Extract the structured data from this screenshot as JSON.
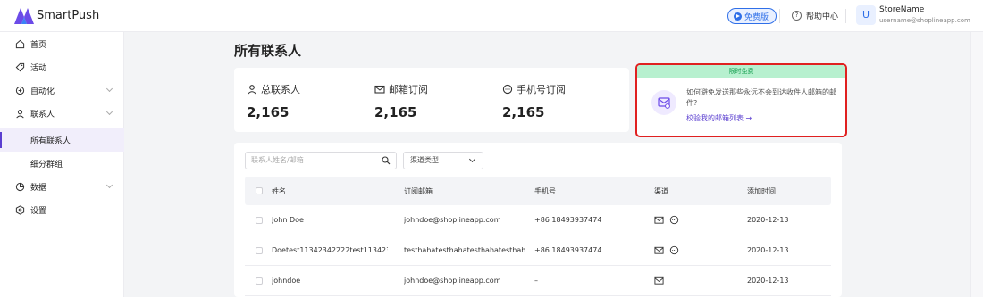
{
  "app": {
    "brand": "SmartPush",
    "free_badge": "免费版",
    "help": "帮助中心",
    "avatar_letter": "U",
    "store_name": "StoreName",
    "store_email": "username@shoplineapp.com"
  },
  "sidebar": {
    "items": [
      {
        "label": "首页",
        "icon": "home-icon"
      },
      {
        "label": "活动",
        "icon": "tag-icon"
      },
      {
        "label": "自动化",
        "icon": "automation-icon"
      },
      {
        "label": "联系人",
        "icon": "user-icon"
      },
      {
        "label": "所有联系人"
      },
      {
        "label": "细分群组"
      },
      {
        "label": "数据",
        "icon": "chart-icon"
      },
      {
        "label": "设置",
        "icon": "settings-icon"
      }
    ]
  },
  "page": {
    "title": "所有联系人"
  },
  "stats": {
    "total_label": "总联系人",
    "total_value": "2,165",
    "email_label": "邮箱订阅",
    "email_value": "2,165",
    "sms_label": "手机号订阅",
    "sms_value": "2,165"
  },
  "promo": {
    "header": "限时免费",
    "text": "如何避免发送那些永远不会到达收件人邮箱的邮件?",
    "link": "校验我的邮箱列表 →"
  },
  "filters": {
    "search_placeholder": "联系人姓名/邮箱",
    "channel_select": "渠道类型"
  },
  "table": {
    "headers": {
      "name": "姓名",
      "email": "订阅邮箱",
      "phone": "手机号",
      "channel": "渠道",
      "date": "添加时间"
    },
    "rows": [
      {
        "name": "John Doe",
        "email": "johndoe@shoplineapp.com",
        "phone": "+86 18493937474",
        "date": "2020-12-13"
      },
      {
        "name": "Doetest11342342222test1134234...",
        "email": "testhahatesthahatesthahatesthah...",
        "phone": "+86 18493937474",
        "date": "2020-12-13"
      },
      {
        "name": "johndoe",
        "email": "johndoe@shoplineapp.com",
        "phone": "–",
        "date": "2020-12-13"
      }
    ]
  },
  "colors": {
    "accent": "#5b3fd0",
    "highlight_border": "#e02020",
    "promo_header_bg": "#b7f0cf"
  }
}
